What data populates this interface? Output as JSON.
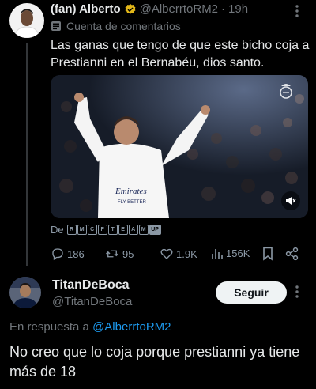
{
  "tweet": {
    "display_name": "(fan) Alberto",
    "handle": "@AlberrtoRM2",
    "separator": "·",
    "time": "19h",
    "account_label": "Cuenta de comentarios",
    "text": "Las ganas que tengo de que este bicho coja a Prestianni en el Bernabéu, dios santo.",
    "media": {
      "shirt_text": "Emirates",
      "shirt_text_2": "FLY BETTER"
    },
    "via": {
      "prefix": "De",
      "brand_letters": [
        "R",
        "M",
        "C",
        "F",
        "T",
        "E",
        "A",
        "M",
        "UP"
      ]
    },
    "stats": {
      "replies": "186",
      "retweets": "95",
      "likes": "1.9K",
      "views": "156K"
    }
  },
  "reply": {
    "display_name": "TitanDeBoca",
    "handle": "@TitanDeBoca",
    "follow_label": "Seguir",
    "in_reply_prefix": "En respuesta a",
    "in_reply_handle": "@AlberrtoRM2",
    "text": "No creo que lo coja porque prestianni ya tiene más de 18"
  },
  "colors": {
    "background": "#000000",
    "text": "#e7e9ea",
    "muted": "#71767b",
    "accent": "#1d9bf0",
    "verified_gold": "#e2b719"
  }
}
